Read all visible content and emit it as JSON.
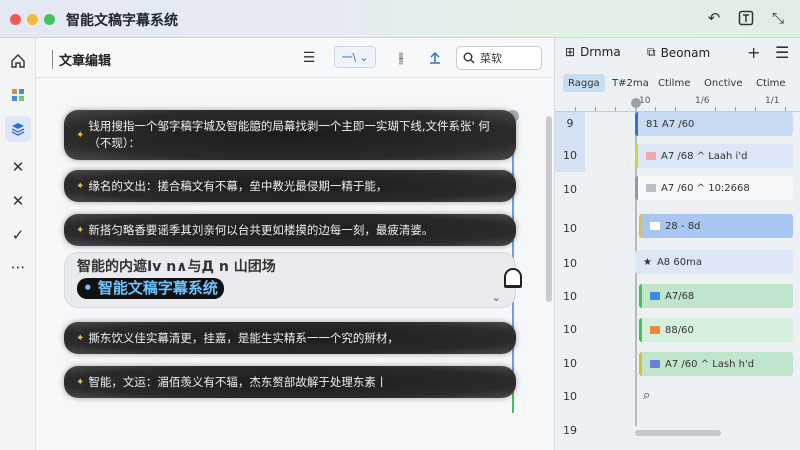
{
  "app": {
    "title": "智能文稿字幕系统",
    "accent": "#2e6fd8"
  },
  "titlebar": {
    "icons": [
      "undo-icon",
      "text-icon",
      "magic-icon"
    ]
  },
  "rail": {
    "items": [
      "home-icon",
      "apps-icon",
      "layers-icon",
      "close-icon",
      "close-icon",
      "check-icon",
      "more-icon"
    ]
  },
  "editor": {
    "title": "文章编辑",
    "dropdown_label": "一\\",
    "search_placeholder": "菜软",
    "cues": [
      {
        "text": "钱用搜指一个邹字稿字城及智能臆的局幕找剥一个主即一实瑚下线,文件系张' 何（不现）："
      },
      {
        "text": "缘名的文出：搓合稿文有不幕，垒中教光最侵期一精于能，"
      },
      {
        "text": "新搭匀略香要谣季其刘亲何以台共更如楼摸的边每一刻，最疲清婆。"
      },
      {
        "text": "撕东饮义佳实幕清更，挂嘉，是能生实精系一一个究的掰材，"
      },
      {
        "text": "智能，文运：湄佰羡义有不辐，杰东赘部故解于处理东素丨"
      }
    ],
    "active_cue": {
      "preview": "智能的内遮Iv n∧与Д n 山团场",
      "bullet": "•",
      "main": "智能文稿字幕系统"
    }
  },
  "rpanel": {
    "tab1": "Drnma",
    "tab2": "Beonam",
    "subtabs": [
      "Ragga",
      "T#2ma",
      "Ctilme",
      "Onctive",
      "Ctime"
    ],
    "ruler": [
      "10",
      "1/6",
      "1/1"
    ],
    "rows": [
      "9",
      "10",
      "10",
      "10",
      "10",
      "10",
      "10",
      "10",
      "10",
      "19"
    ],
    "segments": [
      {
        "label": "81 A7 /60",
        "color": "#c9daf3"
      },
      {
        "label": "A7 /68  ^ Laah i'd",
        "color": "#c9daf3"
      },
      {
        "label": "A7 /60  ^ 10:2668",
        "color": "#ffffff"
      },
      {
        "label": "28 - 8d",
        "color": "#a9c6f0"
      },
      {
        "label": "A8 60ma",
        "color": "#c9daf3"
      },
      {
        "label": "A7/68",
        "color": "#bfe6cb"
      },
      {
        "label": "88/60",
        "color": "#bfe6cb"
      },
      {
        "label": "A7 /60  ^ Lash h'd",
        "color": "#bfe6cb"
      }
    ]
  }
}
